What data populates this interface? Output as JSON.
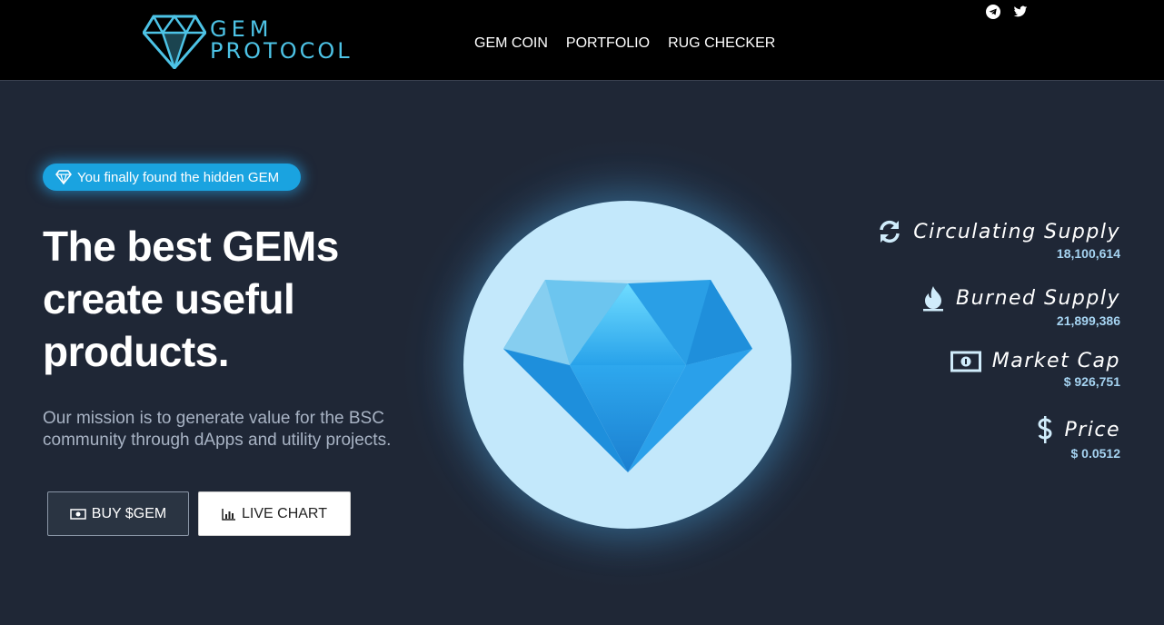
{
  "brand": {
    "line1": "GEM",
    "line2": "PROTOCOL"
  },
  "nav": [
    {
      "label": "GEM COIN"
    },
    {
      "label": "PORTFOLIO"
    },
    {
      "label": "RUG CHECKER"
    }
  ],
  "social": [
    "telegram-icon",
    "twitter-icon"
  ],
  "hero": {
    "badge": "You finally found the hidden GEM",
    "headline_lines": [
      "The best GEMs",
      "create useful",
      "products."
    ],
    "mission": "Our mission is to generate value for the BSC community through dApps and utility projects.",
    "buttons": {
      "buy": "BUY $GEM",
      "chart": "LIVE CHART"
    }
  },
  "stats": [
    {
      "icon": "refresh-icon",
      "label": "Circulating Supply",
      "value": "18,100,614"
    },
    {
      "icon": "flame-icon",
      "label": "Burned Supply",
      "value": "21,899,386"
    },
    {
      "icon": "money-bill-icon",
      "label": "Market Cap",
      "value": "$ 926,751"
    },
    {
      "icon": "dollar-icon",
      "label": "Price",
      "value": "$ 0.0512"
    }
  ],
  "colors": {
    "header_bg": "#000000",
    "page_bg": "#1f2736",
    "brand": "#4dc3e6",
    "badge": "#1aa3e0",
    "stat_value": "#a6d4f2",
    "orb": "#c3e8fb"
  }
}
